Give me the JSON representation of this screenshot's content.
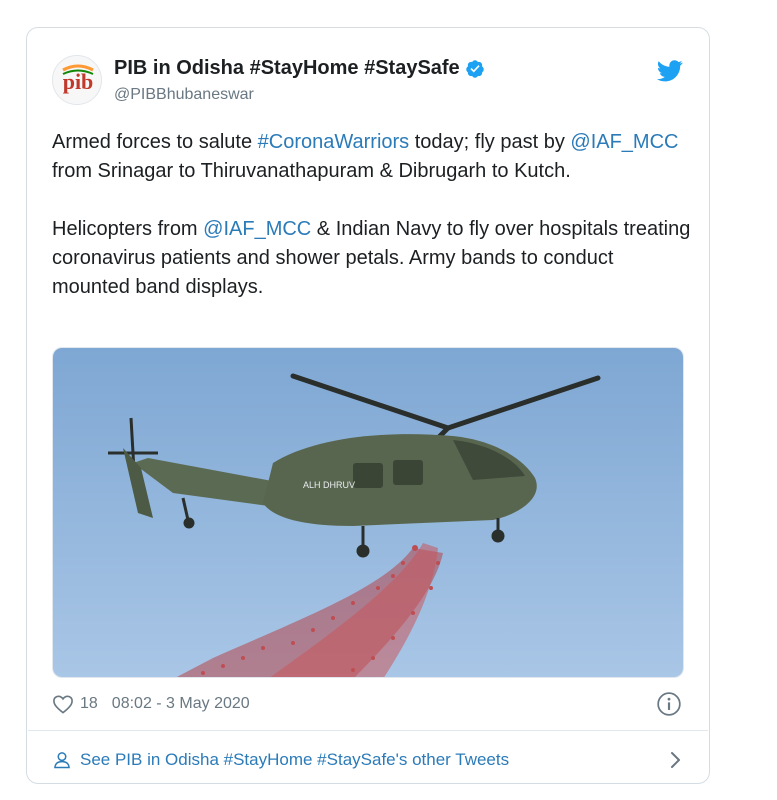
{
  "tweet": {
    "display_name": "PIB in Odisha #StayHome #StaySafe",
    "handle": "@PIBBhubaneswar",
    "avatar_text": "pib",
    "paragraph1": {
      "part1": "Armed forces to salute ",
      "hashtag": "#CoronaWarriors",
      "part2": " today; fly past by ",
      "mention": "@IAF_MCC",
      "part3": " from Srinagar to Thiruvanathapuram & Dibrugarh to Kutch."
    },
    "paragraph2": {
      "part1": "Helicopters from ",
      "mention": "@IAF_MCC",
      "part2": " & Indian Navy to fly over hospitals treating coronavirus patients and shower petals. Army bands to conduct mounted band displays."
    },
    "media": {
      "description_icon": "helicopter-photo",
      "aircraft_marking": "ALH DHRUV"
    },
    "likes": "18",
    "timestamp": "08:02 - 3 May 2020"
  },
  "footer": {
    "label": "See PIB in Odisha #StayHome #StaySafe's other Tweets"
  },
  "colors": {
    "link": "#2b7bb9",
    "muted": "#697882",
    "text": "#1c2022",
    "twitter_blue": "#1da1f2",
    "border": "#d5dde3"
  },
  "icons": [
    "twitter-bird-icon",
    "verified-badge-icon",
    "heart-icon",
    "info-icon",
    "person-icon",
    "chevron-right-icon"
  ]
}
